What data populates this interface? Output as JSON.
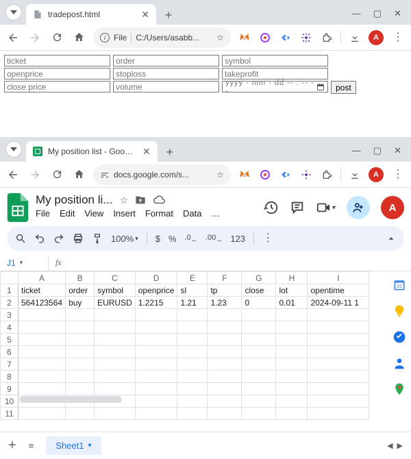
{
  "top": {
    "tab_title": "tradepost.html",
    "addr_label": "File",
    "addr_path": "C:/Users/asabb...",
    "form": {
      "ticket": "ticket",
      "order": "order",
      "symbol": "symbol",
      "openprice": "openprice",
      "stoploss": "stoploss",
      "takeprofit": "takeprofit",
      "closeprice": "close price",
      "volume": "volume",
      "date_placeholder": "yyyy - mm - dd   -- : --   --",
      "post": "post"
    }
  },
  "bottom": {
    "tab_title": "My position list - Google Sheet",
    "addr": "docs.google.com/s...",
    "doc_title": "My position li...",
    "menus": [
      "File",
      "Edit",
      "View",
      "Insert",
      "Format",
      "Data",
      "…"
    ],
    "zoom": "100%",
    "fmt_123": "123",
    "cell_ref": "J1",
    "cols": [
      "A",
      "B",
      "C",
      "D",
      "E",
      "F",
      "G",
      "H",
      "I"
    ],
    "headers": [
      "ticket",
      "order",
      "symbol",
      "openprice",
      "sl",
      "tp",
      "close",
      "lot",
      "opentime"
    ],
    "row2": [
      "564123564",
      "buy",
      "EURUSD",
      "1.2215",
      "1.21",
      "1.23",
      "0",
      "0.01",
      "2024-09-11 1"
    ],
    "sheet_name": "Sheet1",
    "avatar": "A"
  }
}
